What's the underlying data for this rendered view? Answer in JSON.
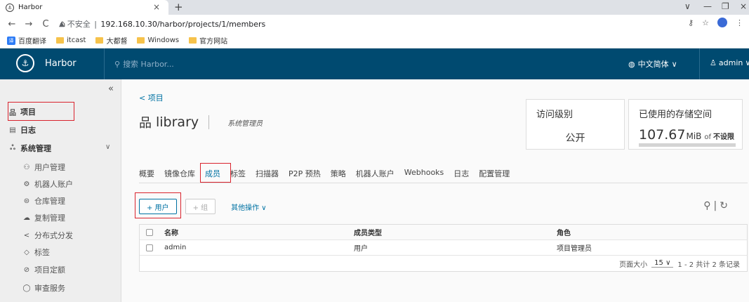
{
  "browser": {
    "tab_title": "Harbor",
    "tab_close": "×",
    "new_tab": "+",
    "win_min": "—",
    "win_max": "❐",
    "win_close": "×",
    "chevron_down": "∨",
    "insecure_label": "不安全",
    "url": "192.168.10.30/harbor/projects/1/members",
    "bookmarks": [
      "百度翻译",
      "itcast",
      "大都督",
      "Windows",
      "官方网站"
    ]
  },
  "header": {
    "brand": "Harbor",
    "search_placeholder": "搜索 Harbor...",
    "language": "中文简体",
    "user": "admin"
  },
  "sidebar": {
    "items": [
      {
        "label": "项目",
        "icon": "project-icon"
      },
      {
        "label": "日志",
        "icon": "log-icon"
      },
      {
        "label": "系统管理",
        "icon": "admin-icon"
      }
    ],
    "sub_items": [
      {
        "label": "用户管理"
      },
      {
        "label": "机器人账户"
      },
      {
        "label": "仓库管理"
      },
      {
        "label": "复制管理"
      },
      {
        "label": "分布式分发"
      },
      {
        "label": "标签"
      },
      {
        "label": "项目定额"
      },
      {
        "label": "审查服务"
      }
    ]
  },
  "main": {
    "back_link": "< 项目",
    "project_name": "library",
    "project_role": "系统管理员",
    "access_card": {
      "title": "访问级别",
      "value": "公开"
    },
    "storage_card": {
      "title": "已使用的存储空间",
      "value": "107.67",
      "unit": "MiB",
      "of": "of",
      "limit": "不设限",
      "usage_fraction": 0.0
    },
    "tabs": [
      "概要",
      "镜像仓库",
      "成员",
      "标签",
      "扫描器",
      "P2P 预热",
      "策略",
      "机器人账户",
      "Webhooks",
      "日志",
      "配置管理"
    ],
    "active_tab": "成员",
    "add_user_button": "+ 用户",
    "add_group_button": "+ 组",
    "more_actions": "其他操作 ∨",
    "table": {
      "headers": [
        "名称",
        "成员类型",
        "角色"
      ],
      "rows": [
        [
          "admin",
          "用户",
          "项目管理员"
        ]
      ]
    },
    "page_size_label": "页面大小",
    "page_size": "15",
    "pagination_summary": "1 - 2 共计 2 条记录"
  },
  "colors": {
    "header_bg": "#004a70",
    "accent": "#0072a3",
    "highlight_box": "#d9232d"
  }
}
